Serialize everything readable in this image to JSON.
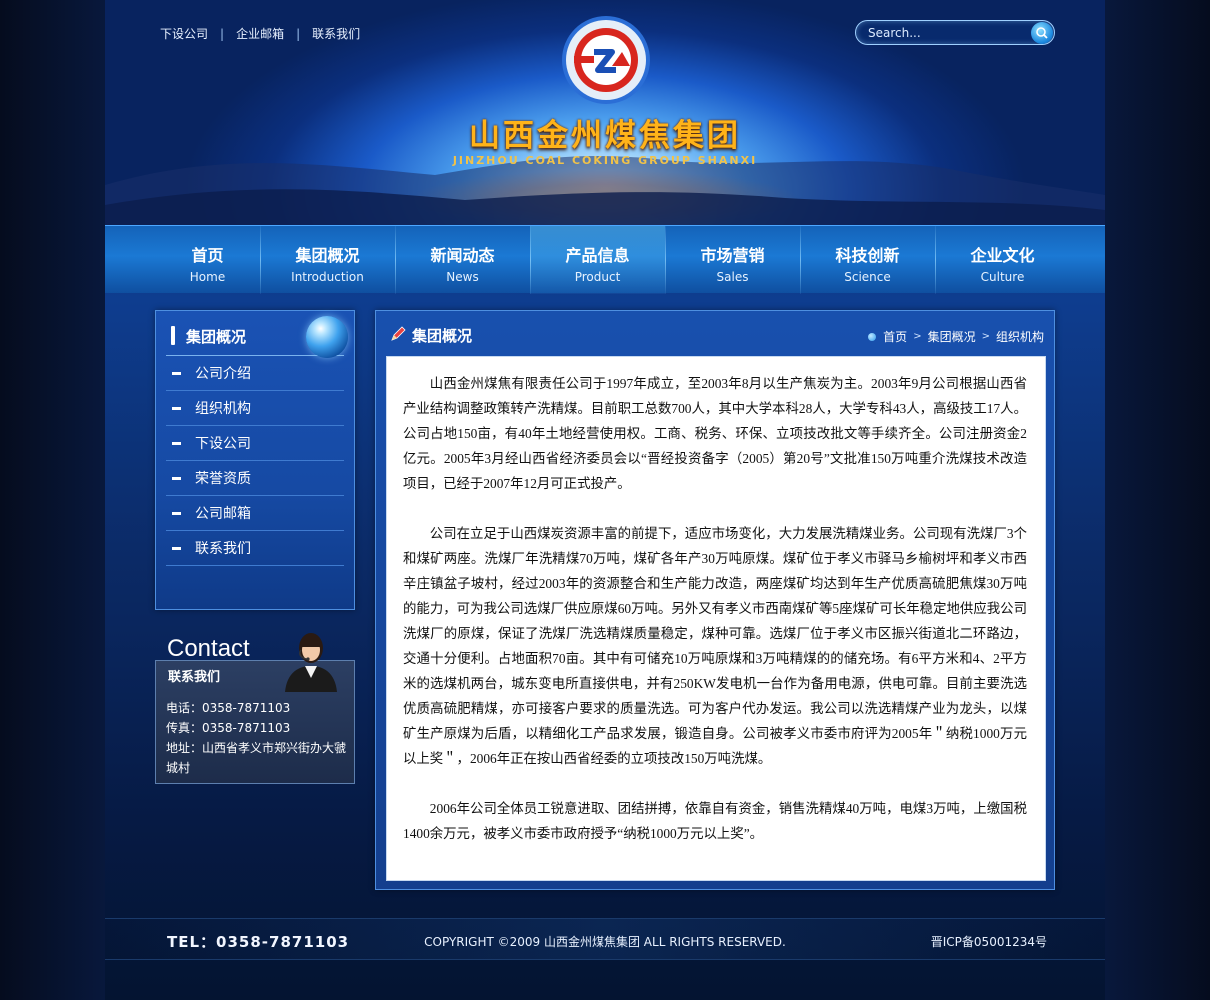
{
  "top_links": [
    "下设公司",
    "企业邮箱",
    "联系我们"
  ],
  "search": {
    "placeholder": "Search..."
  },
  "brand": {
    "name_cn": "山西金州煤焦集团",
    "name_en": "JINZHOU COAL COKING GROUP SHANXI"
  },
  "nav": [
    {
      "cn": "首页",
      "en": "Home"
    },
    {
      "cn": "集团概况",
      "en": "Introduction"
    },
    {
      "cn": "新闻动态",
      "en": "News"
    },
    {
      "cn": "产品信息",
      "en": "Product"
    },
    {
      "cn": "市场营销",
      "en": "Sales"
    },
    {
      "cn": "科技创新",
      "en": "Science"
    },
    {
      "cn": "企业文化",
      "en": "Culture"
    }
  ],
  "sidebar": {
    "title": "集团概况",
    "items": [
      "公司介绍",
      "组织机构",
      "下设公司",
      "荣誉资质",
      "公司邮箱",
      "联系我们"
    ]
  },
  "contact": {
    "heading": "Contact",
    "title": "联系我们",
    "phone": "电话：0358-7871103",
    "fax": "传真：0358-7871103",
    "address": "地址：山西省孝义市郑兴街办大虢城村"
  },
  "content": {
    "title": "集团概况",
    "breadcrumb": [
      "首页",
      "集团概况",
      "组织机构"
    ],
    "paragraphs": [
      "山西金州煤焦有限责任公司于1997年成立，至2003年8月以生产焦炭为主。2003年9月公司根据山西省产业结构调整政策转产洗精煤。目前职工总数700人，其中大学本科28人，大学专科43人，高级技工17人。公司占地150亩，有40年土地经营使用权。工商、税务、环保、立项技改批文等手续齐全。公司注册资金2亿元。2005年3月经山西省经济委员会以“晋经投资备字（2005）第20号”文批准150万吨重介洗煤技术改造项目，已经于2007年12月可正式投产。",
      "公司在立足于山西煤炭资源丰富的前提下，适应市场变化，大力发展洗精煤业务。公司现有洗煤厂3个和煤矿两座。洗煤厂年洗精煤70万吨，煤矿各年产30万吨原煤。煤矿位于孝义市驿马乡榆树坪和孝义市西辛庄镇盆子坡村，经过2003年的资源整合和生产能力改造，两座煤矿均达到年生产优质高硫肥焦煤30万吨的能力，可为我公司选煤厂供应原煤60万吨。另外又有孝义市西南煤矿等5座煤矿可长年稳定地供应我公司洗煤厂的原煤，保证了洗煤厂洗选精煤质量稳定，煤种可靠。选煤厂位于孝义市区振兴街道北二环路边，交通十分便利。占地面积70亩。其中有可储充10万吨原煤和3万吨精煤的的储充场。有6平方米和4、2平方米的选煤机两台，城东变电所直接供电，并有250KW发电机一台作为备用电源，供电可靠。目前主要洗选优质高硫肥精煤，亦可接客户要求的质量洗选。可为客户代办发运。我公司以洗选精煤产业为龙头，以煤矿生产原煤为后盾，以精细化工产品求发展，锻造自身。公司被孝义市委市府评为2005年＂纳税1000万元以上奖＂，2006年正在按山西省经委的立项技改150万吨洗煤。",
      "2006年公司全体员工锐意进取、团结拼搏，依靠自有资金，销售洗精煤40万吨，电煤3万吨，上缴国税1400余万元，被孝义市委市政府授予“纳税1000万元以上奖”。"
    ]
  },
  "footer": {
    "tel": "TEL：0358-7871103",
    "copyright": "COPYRIGHT ©2009 山西金州煤焦集团 ALL RIGHTS RESERVED.",
    "icp": "晋ICP备05001234号"
  }
}
